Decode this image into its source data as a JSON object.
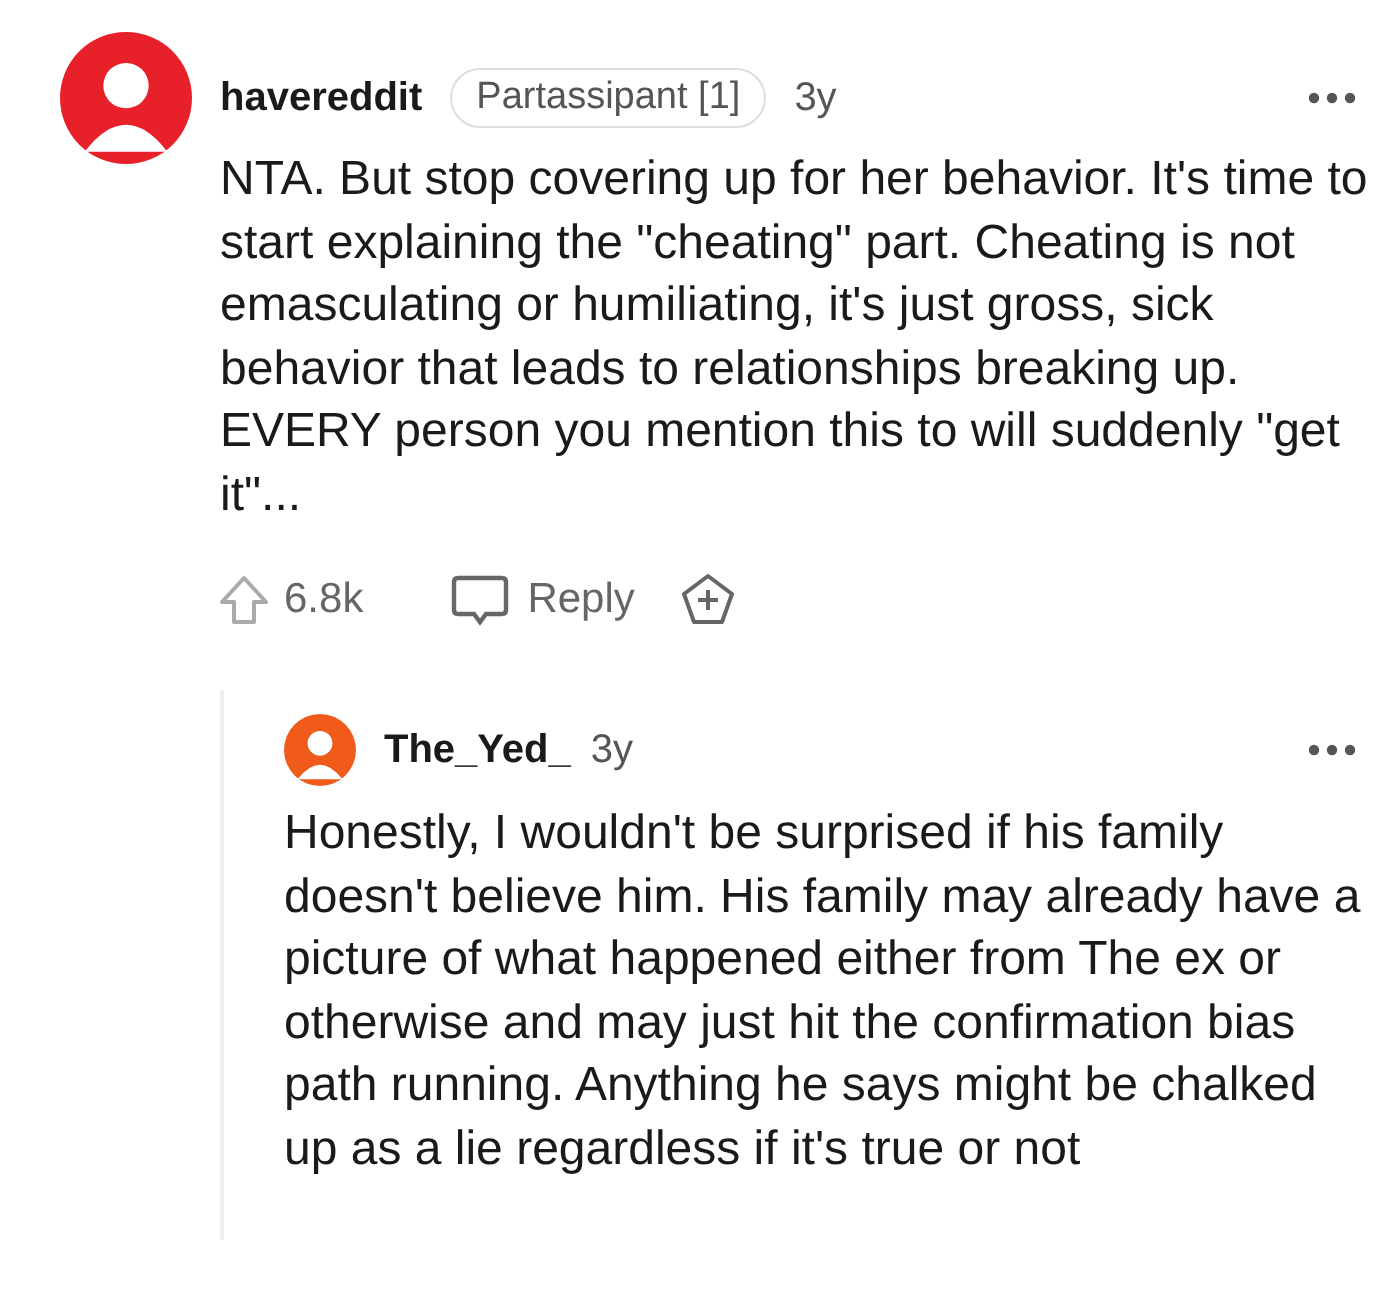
{
  "comment": {
    "author": "havereddit",
    "flair": "Partassipant [1]",
    "age": "3y",
    "body": "NTA. But stop covering up for her behavior. It's time to start explaining the \"cheating\" part. Cheating is not emasculating or humiliating, it's just gross, sick behavior that leads to relationships breaking up. EVERY person you mention this to will suddenly \"get it\"...",
    "votes": "6.8k",
    "reply_label": "Reply"
  },
  "reply": {
    "author": "The_Yed_",
    "age": "3y",
    "body": "Honestly, I wouldn't be surprised if his family doesn't believe him. His family may already have a picture of what happened either from The ex or otherwise and may just hit the confirmation bias path running. Anything he says might be chalked up as a lie regardless if it's true or not"
  }
}
